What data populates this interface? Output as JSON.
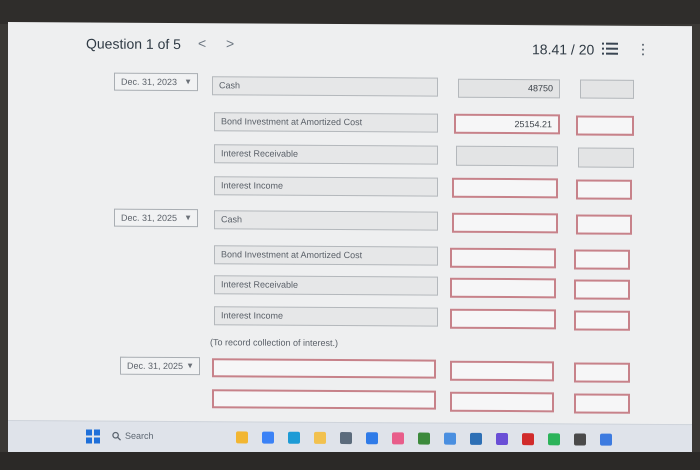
{
  "header": {
    "question_label": "Question 1 of 5",
    "prev": "<",
    "next": ">",
    "score": "18.41 / 20",
    "more": "⋮"
  },
  "entries": [
    {
      "date": "Dec. 31, 2023",
      "lines": [
        {
          "account": "Cash",
          "debit": "48750",
          "credit": ""
        },
        {
          "account": "Bond Investment at Amortized Cost",
          "debit": "25154.21",
          "credit": ""
        },
        {
          "account": "Interest Receivable",
          "debit": "",
          "credit": ""
        },
        {
          "account": "Interest Income",
          "debit": "",
          "credit": ""
        }
      ]
    },
    {
      "date": "Dec. 31, 2025",
      "lines": [
        {
          "account": "Cash",
          "debit": "",
          "credit": ""
        },
        {
          "account": "Bond Investment at Amortized Cost",
          "debit": "",
          "credit": ""
        },
        {
          "account": "Interest Receivable",
          "debit": "",
          "credit": ""
        },
        {
          "account": "Interest Income",
          "debit": "",
          "credit": ""
        }
      ],
      "note": "(To record collection of interest.)"
    },
    {
      "date": "Dec. 31, 2025",
      "lines": [
        {
          "account": "",
          "debit": "",
          "credit": ""
        },
        {
          "account": "",
          "debit": "",
          "credit": ""
        }
      ]
    }
  ],
  "taskbar": {
    "search_label": "Search",
    "icons": [
      {
        "name": "file-explorer-icon",
        "color": "#f2b632"
      },
      {
        "name": "chrome-icon",
        "color": "#3b82f6"
      },
      {
        "name": "edge-icon",
        "color": "#1d9bd6"
      },
      {
        "name": "folder-icon",
        "color": "#f2c14e"
      },
      {
        "name": "store-icon",
        "color": "#5b6b7c"
      },
      {
        "name": "mail-icon",
        "color": "#2f7be8"
      },
      {
        "name": "paint-icon",
        "color": "#e85d8a"
      },
      {
        "name": "game-icon",
        "color": "#3c8a3c"
      },
      {
        "name": "photos-icon",
        "color": "#4a8fe0"
      },
      {
        "name": "app-icon",
        "color": "#2d6fb5"
      },
      {
        "name": "media-icon",
        "color": "#6a4fd6"
      },
      {
        "name": "netflix-icon",
        "color": "#d12b2b"
      },
      {
        "name": "spotify-icon",
        "color": "#2bb35a"
      },
      {
        "name": "text-icon",
        "color": "#4a4a4a"
      },
      {
        "name": "calendar-icon",
        "color": "#3d7be0"
      }
    ]
  }
}
